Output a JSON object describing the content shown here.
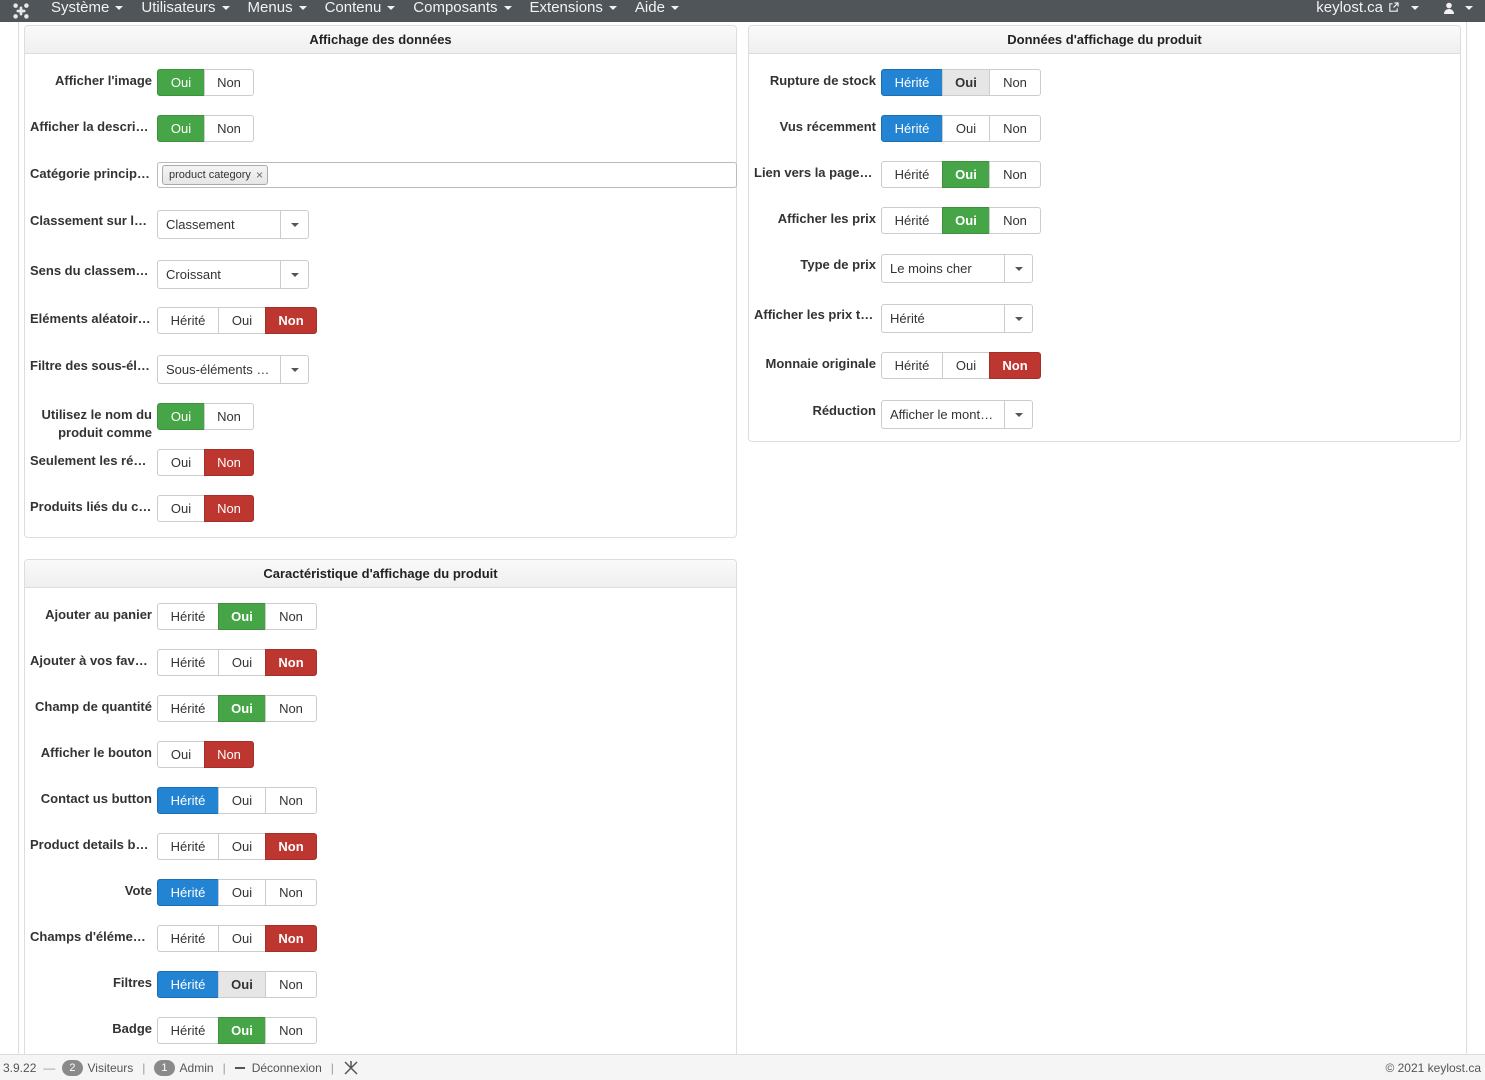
{
  "nav": {
    "menus": [
      "Système",
      "Utilisateurs",
      "Menus",
      "Contenu",
      "Composants",
      "Extensions",
      "Aide"
    ],
    "site": "keylost.ca"
  },
  "panel_data": {
    "title": "Affichage des données",
    "rows": [
      {
        "label": "Afficher l'image",
        "type": "toggle",
        "options": [
          "Oui",
          "Non"
        ],
        "selected": "Oui"
      },
      {
        "label": "Afficher la description",
        "type": "toggle",
        "options": [
          "Oui",
          "Non"
        ],
        "selected": "Oui"
      },
      {
        "label": "Catégorie principale",
        "type": "tags",
        "tags": [
          "product category"
        ]
      },
      {
        "label": "Classement sur la liste",
        "type": "select",
        "value": "Classement"
      },
      {
        "label": "Sens du classement",
        "type": "select",
        "value": "Croissant"
      },
      {
        "label": "Eléments aléatoires",
        "type": "toggle",
        "options": [
          "Hérité",
          "Oui",
          "Non"
        ],
        "selected": "Non"
      },
      {
        "label": "Filtre des sous-éléments",
        "type": "select",
        "value": "Sous-éléments de la catégorie"
      },
      {
        "label": "Utilisez le nom du produit comme titre",
        "type": "toggle",
        "options": [
          "Oui",
          "Non"
        ],
        "selected": "Oui"
      },
      {
        "label": "Seulement les résultats",
        "type": "toggle",
        "options": [
          "Oui",
          "Non"
        ],
        "selected": "Non"
      },
      {
        "label": "Produits liés du catalogue",
        "type": "toggle",
        "options": [
          "Oui",
          "Non"
        ],
        "selected": "Non"
      }
    ]
  },
  "panel_product": {
    "title": "Données d'affichage du produit",
    "rows": [
      {
        "label": "Rupture de stock",
        "type": "toggle",
        "options": [
          "Hérité",
          "Oui",
          "Non"
        ],
        "selected": "Hérité",
        "highlight": "Oui"
      },
      {
        "label": "Vus récemment",
        "type": "toggle",
        "options": [
          "Hérité",
          "Oui",
          "Non"
        ],
        "selected": "Hérité"
      },
      {
        "label": "Lien vers la page du produit",
        "type": "toggle",
        "options": [
          "Hérité",
          "Oui",
          "Non"
        ],
        "selected": "Oui"
      },
      {
        "label": "Afficher les prix",
        "type": "toggle",
        "options": [
          "Hérité",
          "Oui",
          "Non"
        ],
        "selected": "Oui"
      },
      {
        "label": "Type de prix",
        "type": "select",
        "value": "Le moins cher"
      },
      {
        "label": "Afficher les prix toutes taxes",
        "type": "select",
        "value": "Hérité"
      },
      {
        "label": "Monnaie originale",
        "type": "toggle",
        "options": [
          "Hérité",
          "Oui",
          "Non"
        ],
        "selected": "Non"
      },
      {
        "label": "Réduction",
        "type": "select",
        "value": "Afficher le montant de la réduction"
      }
    ]
  },
  "panel_features": {
    "title": "Caractéristique d'affichage du produit",
    "rows": [
      {
        "label": "Ajouter au panier",
        "type": "toggle",
        "options": [
          "Hérité",
          "Oui",
          "Non"
        ],
        "selected": "Oui"
      },
      {
        "label": "Ajouter à vos favoris",
        "type": "toggle",
        "options": [
          "Hérité",
          "Oui",
          "Non"
        ],
        "selected": "Non"
      },
      {
        "label": "Champ de quantité",
        "type": "toggle",
        "options": [
          "Hérité",
          "Oui",
          "Non"
        ],
        "selected": "Oui"
      },
      {
        "label": "Afficher le bouton",
        "type": "toggle",
        "options": [
          "Oui",
          "Non"
        ],
        "selected": "Non"
      },
      {
        "label": "Contact us button",
        "type": "toggle",
        "options": [
          "Hérité",
          "Oui",
          "Non"
        ],
        "selected": "Hérité"
      },
      {
        "label": "Product details button",
        "type": "toggle",
        "options": [
          "Hérité",
          "Oui",
          "Non"
        ],
        "selected": "Non"
      },
      {
        "label": "Vote",
        "type": "toggle",
        "options": [
          "Hérité",
          "Oui",
          "Non"
        ],
        "selected": "Hérité"
      },
      {
        "label": "Champs d'éléments",
        "type": "toggle",
        "options": [
          "Hérité",
          "Oui",
          "Non"
        ],
        "selected": "Non"
      },
      {
        "label": "Filtres",
        "type": "toggle",
        "options": [
          "Hérité",
          "Oui",
          "Non"
        ],
        "selected": "Hérité",
        "highlight": "Oui"
      },
      {
        "label": "Badge",
        "type": "toggle",
        "options": [
          "Hérité",
          "Oui",
          "Non"
        ],
        "selected": "Oui"
      }
    ]
  },
  "status": {
    "version": "3.9.22",
    "visitors_count": "2",
    "visitors_label": "Visiteurs",
    "admin_count": "1",
    "admin_label": "Admin",
    "logout_label": "Déconnexion",
    "copyright": "© 2021 keylost.ca"
  },
  "colors": {
    "nav_bg": "#505559",
    "green": "#46a546",
    "blue": "#2384d3",
    "red": "#bd362f"
  }
}
